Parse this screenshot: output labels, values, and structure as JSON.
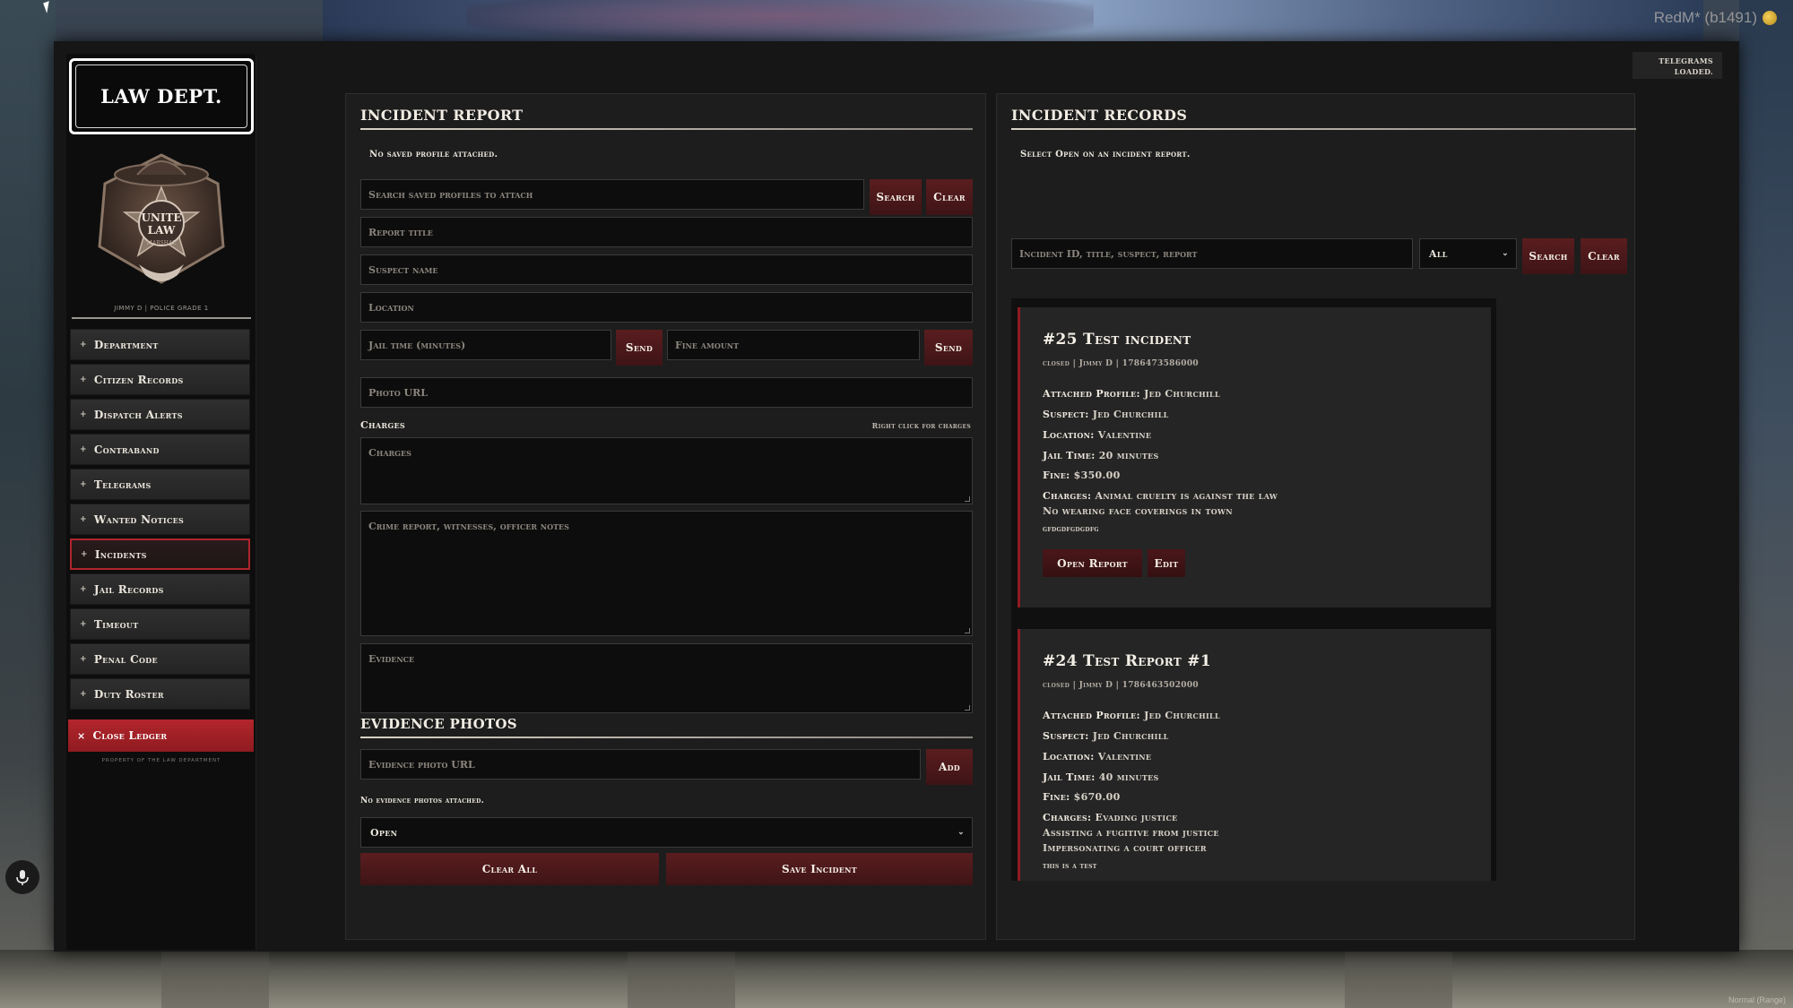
{
  "server": {
    "tag": "RedM* (b1491)",
    "corner": "Normal (Range)"
  },
  "sidebar": {
    "brand": "LAW DEPT.",
    "badge_text": [
      "UNITE",
      "LAW",
      "MARSHAL"
    ],
    "officer": "JIMMY D | POLICE GRADE 1",
    "items": [
      {
        "label": "Department",
        "prefix": "+"
      },
      {
        "label": "Citizen Records",
        "prefix": "+"
      },
      {
        "label": "Dispatch Alerts",
        "prefix": "+"
      },
      {
        "label": "Contraband",
        "prefix": "+"
      },
      {
        "label": "Telegrams",
        "prefix": "+"
      },
      {
        "label": "Wanted Notices",
        "prefix": "+"
      },
      {
        "label": "Incidents",
        "prefix": "+",
        "active": true
      },
      {
        "label": "Jail Records",
        "prefix": "+"
      },
      {
        "label": "Timeout",
        "prefix": "+"
      },
      {
        "label": "Penal Code",
        "prefix": "+"
      },
      {
        "label": "Duty Roster",
        "prefix": "+"
      }
    ],
    "close": {
      "label": "Close Ledger",
      "prefix": "×"
    },
    "property": "PROPERTY OF THE LAW DEPARTMENT"
  },
  "toast": {
    "line1": "TELEGRAMS",
    "line2": "LOADED."
  },
  "report": {
    "title": "INCIDENT REPORT",
    "profile_note": "No saved profile attached.",
    "profile_search_placeholder": "Search saved profiles to attach",
    "search_btn": "Search",
    "clear_btn": "Clear",
    "title_placeholder": "Report title",
    "suspect_placeholder": "Suspect name",
    "location_placeholder": "Location",
    "jail_placeholder": "Jail time (minutes)",
    "send_btn": "Send",
    "fine_placeholder": "Fine amount",
    "send_btn2": "Send",
    "photo_placeholder": "Photo URL",
    "charges_label": "Charges",
    "charges_hint": "Right click for charges",
    "charges_placeholder": "Charges",
    "notes_placeholder": "Crime report, witnesses, officer notes",
    "evidence_placeholder": "Evidence",
    "evidence_photos_title": "EVIDENCE PHOTOS",
    "evidence_url_placeholder": "Evidence photo URL",
    "add_btn": "Add",
    "no_photos": "No evidence photos attached.",
    "status_value": "Open",
    "clear_all_btn": "Clear All",
    "save_btn": "Save Incident"
  },
  "records": {
    "title": "INCIDENT RECORDS",
    "hint": "Select Open on an incident report.",
    "search_placeholder": "Incident ID, title, suspect, report",
    "filter_value": "All",
    "search_btn": "Search",
    "clear_btn": "Clear",
    "cards": [
      {
        "title": "#25 Test incident",
        "meta": "closed | Jimmy D | 1786473586000",
        "profile_label": "Attached Profile:",
        "profile": "Jed Churchill",
        "suspect_label": "Suspect:",
        "suspect": "Jed Churchill",
        "location_label": "Location:",
        "location": "Valentine",
        "jail_label": "Jail Time:",
        "jail": "20 minutes",
        "fine_label": "Fine:",
        "fine": "$350.00",
        "charges_label": "Charges:",
        "charges": [
          "Animal cruelty is against the law",
          "No wearing face coverings in town"
        ],
        "notes": "gfdgdfgdgdfg",
        "open_btn": "Open Report",
        "edit_btn": "Edit"
      },
      {
        "title": "#24 Test Report #1",
        "meta": "closed | Jimmy D | 1786463502000",
        "profile_label": "Attached Profile:",
        "profile": "Jed Churchill",
        "suspect_label": "Suspect:",
        "suspect": "Jed Churchill",
        "location_label": "Location:",
        "location": "Valentine",
        "jail_label": "Jail Time:",
        "jail": "40 minutes",
        "fine_label": "Fine:",
        "fine": "$670.00",
        "charges_label": "Charges:",
        "charges": [
          "Evading justice",
          "Assisting a fugitive from justice",
          "Impersonating a court officer"
        ],
        "notes": "this is a test"
      }
    ]
  }
}
